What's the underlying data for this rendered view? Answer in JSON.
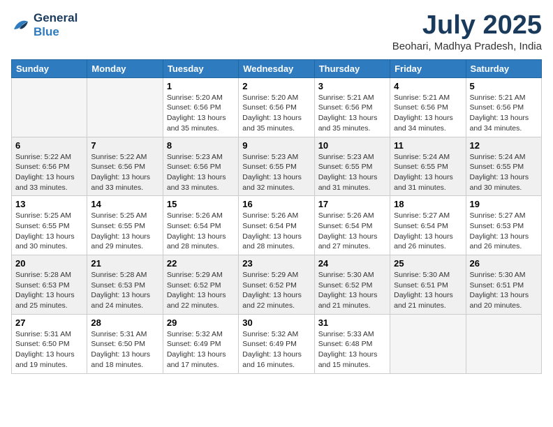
{
  "header": {
    "logo_line1": "General",
    "logo_line2": "Blue",
    "month_title": "July 2025",
    "location": "Beohari, Madhya Pradesh, India"
  },
  "days_of_week": [
    "Sunday",
    "Monday",
    "Tuesday",
    "Wednesday",
    "Thursday",
    "Friday",
    "Saturday"
  ],
  "weeks": [
    {
      "shaded": false,
      "days": [
        {
          "num": "",
          "detail": ""
        },
        {
          "num": "",
          "detail": ""
        },
        {
          "num": "1",
          "detail": "Sunrise: 5:20 AM\nSunset: 6:56 PM\nDaylight: 13 hours\nand 35 minutes."
        },
        {
          "num": "2",
          "detail": "Sunrise: 5:20 AM\nSunset: 6:56 PM\nDaylight: 13 hours\nand 35 minutes."
        },
        {
          "num": "3",
          "detail": "Sunrise: 5:21 AM\nSunset: 6:56 PM\nDaylight: 13 hours\nand 35 minutes."
        },
        {
          "num": "4",
          "detail": "Sunrise: 5:21 AM\nSunset: 6:56 PM\nDaylight: 13 hours\nand 34 minutes."
        },
        {
          "num": "5",
          "detail": "Sunrise: 5:21 AM\nSunset: 6:56 PM\nDaylight: 13 hours\nand 34 minutes."
        }
      ]
    },
    {
      "shaded": true,
      "days": [
        {
          "num": "6",
          "detail": "Sunrise: 5:22 AM\nSunset: 6:56 PM\nDaylight: 13 hours\nand 33 minutes."
        },
        {
          "num": "7",
          "detail": "Sunrise: 5:22 AM\nSunset: 6:56 PM\nDaylight: 13 hours\nand 33 minutes."
        },
        {
          "num": "8",
          "detail": "Sunrise: 5:23 AM\nSunset: 6:56 PM\nDaylight: 13 hours\nand 33 minutes."
        },
        {
          "num": "9",
          "detail": "Sunrise: 5:23 AM\nSunset: 6:55 PM\nDaylight: 13 hours\nand 32 minutes."
        },
        {
          "num": "10",
          "detail": "Sunrise: 5:23 AM\nSunset: 6:55 PM\nDaylight: 13 hours\nand 31 minutes."
        },
        {
          "num": "11",
          "detail": "Sunrise: 5:24 AM\nSunset: 6:55 PM\nDaylight: 13 hours\nand 31 minutes."
        },
        {
          "num": "12",
          "detail": "Sunrise: 5:24 AM\nSunset: 6:55 PM\nDaylight: 13 hours\nand 30 minutes."
        }
      ]
    },
    {
      "shaded": false,
      "days": [
        {
          "num": "13",
          "detail": "Sunrise: 5:25 AM\nSunset: 6:55 PM\nDaylight: 13 hours\nand 30 minutes."
        },
        {
          "num": "14",
          "detail": "Sunrise: 5:25 AM\nSunset: 6:55 PM\nDaylight: 13 hours\nand 29 minutes."
        },
        {
          "num": "15",
          "detail": "Sunrise: 5:26 AM\nSunset: 6:54 PM\nDaylight: 13 hours\nand 28 minutes."
        },
        {
          "num": "16",
          "detail": "Sunrise: 5:26 AM\nSunset: 6:54 PM\nDaylight: 13 hours\nand 28 minutes."
        },
        {
          "num": "17",
          "detail": "Sunrise: 5:26 AM\nSunset: 6:54 PM\nDaylight: 13 hours\nand 27 minutes."
        },
        {
          "num": "18",
          "detail": "Sunrise: 5:27 AM\nSunset: 6:54 PM\nDaylight: 13 hours\nand 26 minutes."
        },
        {
          "num": "19",
          "detail": "Sunrise: 5:27 AM\nSunset: 6:53 PM\nDaylight: 13 hours\nand 26 minutes."
        }
      ]
    },
    {
      "shaded": true,
      "days": [
        {
          "num": "20",
          "detail": "Sunrise: 5:28 AM\nSunset: 6:53 PM\nDaylight: 13 hours\nand 25 minutes."
        },
        {
          "num": "21",
          "detail": "Sunrise: 5:28 AM\nSunset: 6:53 PM\nDaylight: 13 hours\nand 24 minutes."
        },
        {
          "num": "22",
          "detail": "Sunrise: 5:29 AM\nSunset: 6:52 PM\nDaylight: 13 hours\nand 22 minutes."
        },
        {
          "num": "23",
          "detail": "Sunrise: 5:29 AM\nSunset: 6:52 PM\nDaylight: 13 hours\nand 22 minutes."
        },
        {
          "num": "24",
          "detail": "Sunrise: 5:30 AM\nSunset: 6:52 PM\nDaylight: 13 hours\nand 21 minutes."
        },
        {
          "num": "25",
          "detail": "Sunrise: 5:30 AM\nSunset: 6:51 PM\nDaylight: 13 hours\nand 21 minutes."
        },
        {
          "num": "26",
          "detail": "Sunrise: 5:30 AM\nSunset: 6:51 PM\nDaylight: 13 hours\nand 20 minutes."
        }
      ]
    },
    {
      "shaded": false,
      "days": [
        {
          "num": "27",
          "detail": "Sunrise: 5:31 AM\nSunset: 6:50 PM\nDaylight: 13 hours\nand 19 minutes."
        },
        {
          "num": "28",
          "detail": "Sunrise: 5:31 AM\nSunset: 6:50 PM\nDaylight: 13 hours\nand 18 minutes."
        },
        {
          "num": "29",
          "detail": "Sunrise: 5:32 AM\nSunset: 6:49 PM\nDaylight: 13 hours\nand 17 minutes."
        },
        {
          "num": "30",
          "detail": "Sunrise: 5:32 AM\nSunset: 6:49 PM\nDaylight: 13 hours\nand 16 minutes."
        },
        {
          "num": "31",
          "detail": "Sunrise: 5:33 AM\nSunset: 6:48 PM\nDaylight: 13 hours\nand 15 minutes."
        },
        {
          "num": "",
          "detail": ""
        },
        {
          "num": "",
          "detail": ""
        }
      ]
    }
  ]
}
